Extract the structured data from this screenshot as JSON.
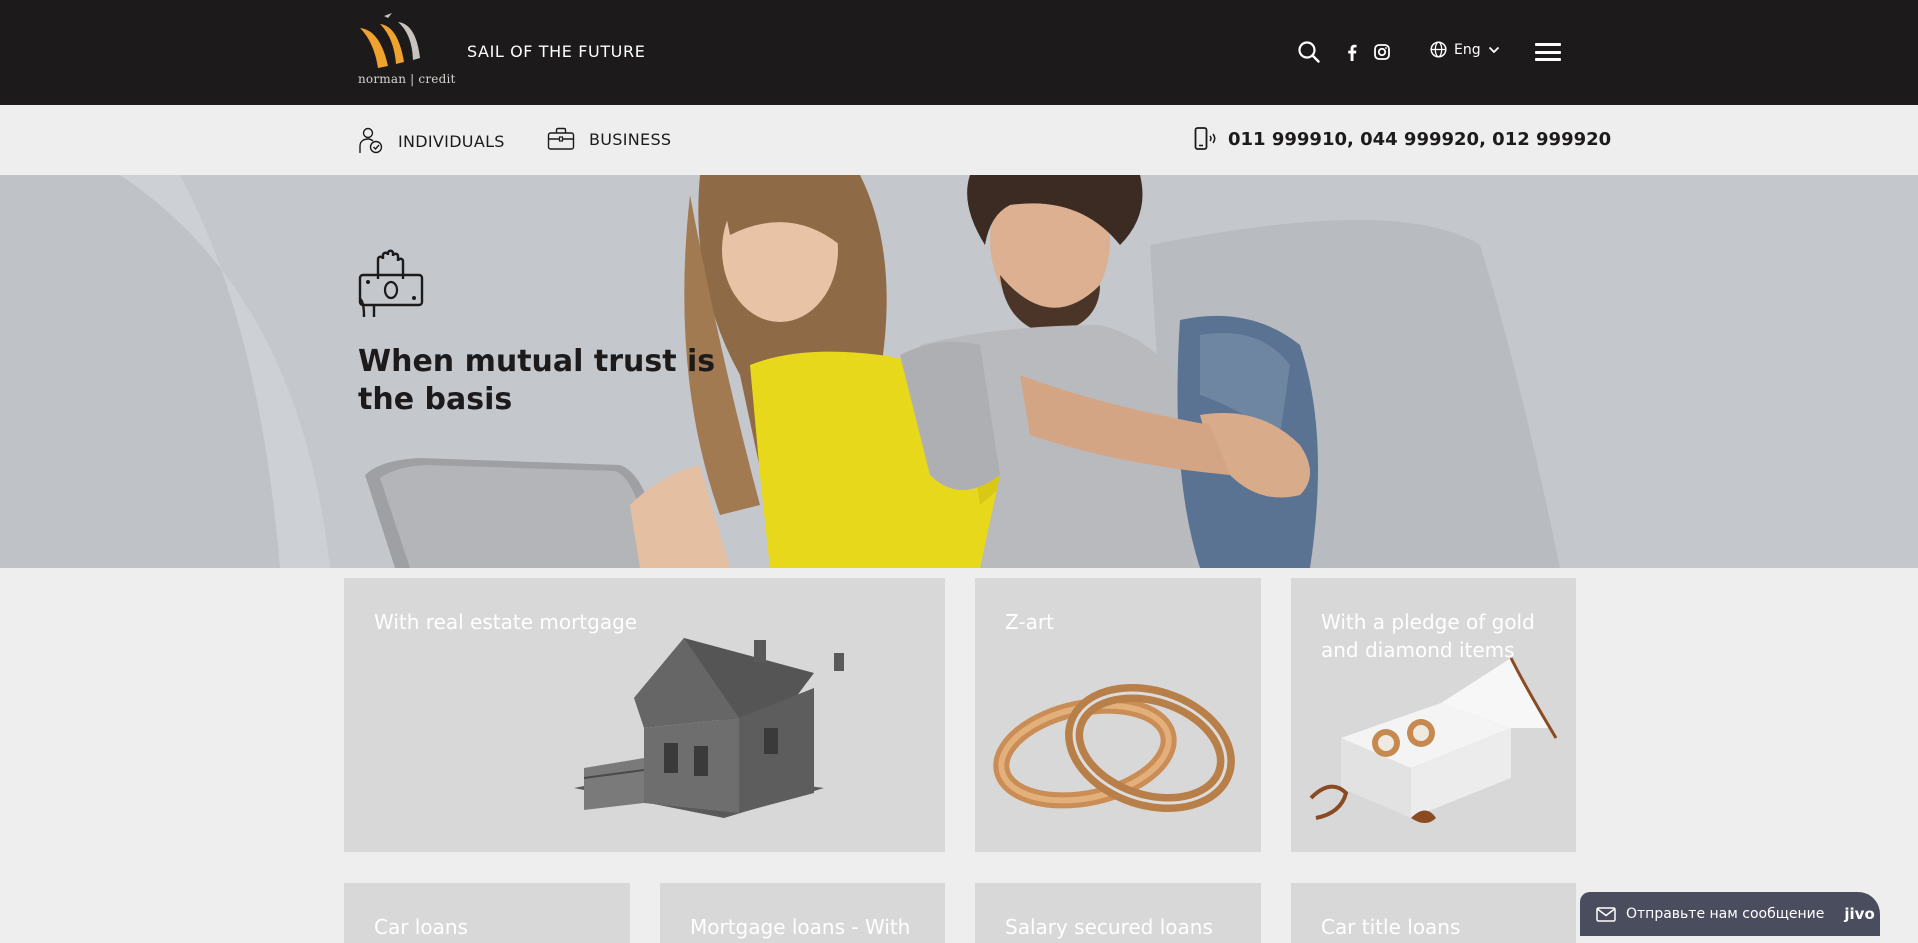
{
  "header": {
    "logo_text": "norman | credit",
    "tagline": "SAIL OF THE FUTURE",
    "language": "Eng",
    "icons": [
      "search-icon",
      "facebook-icon",
      "instagram-icon",
      "globe-icon",
      "chevron-down-icon",
      "hamburger-menu-icon"
    ]
  },
  "subnav": {
    "individuals": "INDIVIDUALS",
    "business": "BUSINESS",
    "phone": "011 999910, 044 999920, 012 999920"
  },
  "hero": {
    "title": "When mutual trust is the basis"
  },
  "cards": {
    "row1": [
      {
        "title": "With real estate mortgage"
      },
      {
        "title": "Z-art"
      },
      {
        "title": "With a pledge of gold and diamond items"
      }
    ],
    "row2": [
      {
        "title": "Car loans"
      },
      {
        "title": "Mortgage loans - With"
      },
      {
        "title": "Salary secured loans"
      },
      {
        "title": "Car title loans"
      }
    ]
  },
  "chat": {
    "label": "Отправьте нам сообщение",
    "brand": "jivo"
  },
  "colors": {
    "topbar": "#1c1a1b",
    "logo_orange": "#f0a22e",
    "page_bg": "#eeeeee",
    "card_bg": "#d8d8d8",
    "chat_bg": "#4a4d5e"
  }
}
